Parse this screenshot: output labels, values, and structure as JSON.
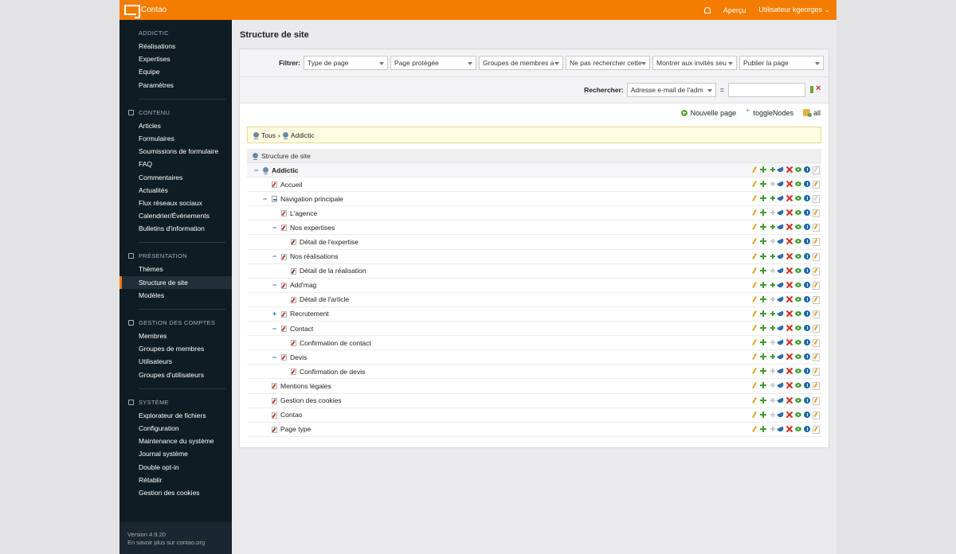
{
  "header": {
    "brand": "Contao",
    "preview": "Aperçu",
    "user": "Utilisateur kgeorges"
  },
  "sidebar": {
    "groups": [
      {
        "title": "ADDICTIC",
        "items": [
          "Réalisations",
          "Expertises",
          "Equipe",
          "Paramètres"
        ]
      },
      {
        "title": "CONTENU",
        "items": [
          "Articles",
          "Formulaires",
          "Soumissions de formulaire",
          "FAQ",
          "Commentaires",
          "Actualités",
          "Flux réseaux sociaux",
          "Calendrier/Événements",
          "Bulletins d'information"
        ]
      },
      {
        "title": "PRÉSENTATION",
        "items": [
          "Thèmes",
          "Structure de site",
          "Modèles"
        ]
      },
      {
        "title": "GESTION DES COMPTES",
        "items": [
          "Membres",
          "Groupes de membres",
          "Utilisateurs",
          "Groupes d'utilisateurs"
        ]
      },
      {
        "title": "SYSTÈME",
        "items": [
          "Explorateur de fichiers",
          "Configuration",
          "Maintenance du système",
          "Journal système",
          "Double opt-in",
          "Rétablir",
          "Gestion des cookies"
        ]
      }
    ],
    "active": "Structure de site",
    "footer": {
      "version": "Version 4.9.20",
      "link": "En savoir plus sur contao.org"
    }
  },
  "main": {
    "title": "Structure de site",
    "filter": {
      "label": "Filtrer:",
      "selects": [
        "Type de page",
        "Page protégée",
        "Groupes de membres a",
        "Ne pas rechercher cette",
        "Montrer aux invités seu",
        "Publier la page"
      ]
    },
    "search": {
      "label": "Rechercher:",
      "field": "Adresse e-mail de l'adm",
      "operator": "=",
      "value": ""
    },
    "actions": {
      "new_page": "Nouvelle page",
      "toggle": "toggleNodes",
      "all": "all"
    },
    "breadcrumb": {
      "root": "Tous",
      "separator": "›",
      "current": "Addictic"
    },
    "tree_header": "Structure de site",
    "rows": [
      {
        "label": "Addictic",
        "level": 0,
        "toggle": "−",
        "icon": "globe",
        "root": true,
        "child_disabled": false,
        "paste_disabled": true
      },
      {
        "label": "Accueil",
        "level": 1,
        "toggle": "",
        "icon": "regular",
        "child_disabled": true,
        "paste_disabled": false
      },
      {
        "label": "Navigation principale",
        "level": 1,
        "toggle": "−",
        "icon": "forward",
        "child_disabled": false,
        "paste_disabled": true
      },
      {
        "label": "L'agence",
        "level": 2,
        "toggle": "",
        "icon": "regular",
        "child_disabled": true,
        "paste_disabled": false
      },
      {
        "label": "Nos expertises",
        "level": 2,
        "toggle": "−",
        "icon": "regular",
        "child_disabled": false,
        "paste_disabled": false
      },
      {
        "label": "Détail de l'expertise",
        "level": 3,
        "toggle": "",
        "icon": "special",
        "child_disabled": true,
        "paste_disabled": false
      },
      {
        "label": "Nos réalisations",
        "level": 2,
        "toggle": "−",
        "icon": "regular",
        "child_disabled": false,
        "paste_disabled": false
      },
      {
        "label": "Détail de la réalisation",
        "level": 3,
        "toggle": "",
        "icon": "special",
        "child_disabled": true,
        "paste_disabled": false
      },
      {
        "label": "Add'mag",
        "level": 2,
        "toggle": "−",
        "icon": "regular",
        "child_disabled": false,
        "paste_disabled": false
      },
      {
        "label": "Détail de l'article",
        "level": 3,
        "toggle": "",
        "icon": "regular",
        "child_disabled": true,
        "paste_disabled": false
      },
      {
        "label": "Recrutement",
        "level": 2,
        "toggle": "+",
        "icon": "regular",
        "child_disabled": false,
        "paste_disabled": false
      },
      {
        "label": "Contact",
        "level": 2,
        "toggle": "−",
        "icon": "regular",
        "child_disabled": false,
        "paste_disabled": false
      },
      {
        "label": "Confirmation de contact",
        "level": 3,
        "toggle": "",
        "icon": "regular",
        "child_disabled": true,
        "paste_disabled": false
      },
      {
        "label": "Devis",
        "level": 2,
        "toggle": "−",
        "icon": "regular",
        "child_disabled": false,
        "paste_disabled": false
      },
      {
        "label": "Confirmation de devis",
        "level": 3,
        "toggle": "",
        "icon": "regular",
        "child_disabled": true,
        "paste_disabled": false
      },
      {
        "label": "Mentions légales",
        "level": 1,
        "toggle": "",
        "icon": "regular",
        "child_disabled": true,
        "paste_disabled": false
      },
      {
        "label": "Gestion des cookies",
        "level": 1,
        "toggle": "",
        "icon": "regular",
        "child_disabled": true,
        "paste_disabled": false
      },
      {
        "label": "Contao",
        "level": 1,
        "toggle": "",
        "icon": "regular",
        "child_disabled": true,
        "paste_disabled": false
      },
      {
        "label": "Page type",
        "level": 1,
        "toggle": "",
        "icon": "special",
        "child_disabled": true,
        "paste_disabled": false
      }
    ]
  },
  "colors": {
    "accent": "#f47c00",
    "sidebar": "#0f1c24"
  }
}
